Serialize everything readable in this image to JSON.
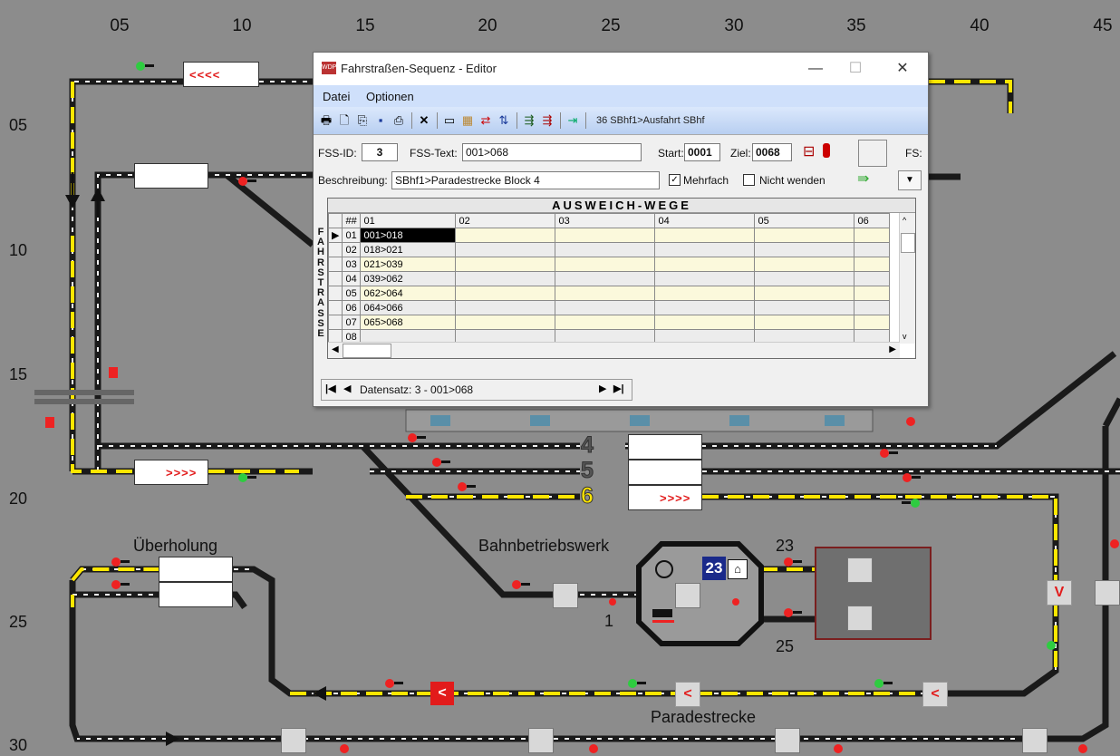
{
  "board": {
    "col_ticks": [
      "05",
      "10",
      "15",
      "20",
      "25",
      "30",
      "35",
      "40",
      "45"
    ],
    "row_ticks": [
      "05",
      "10",
      "15",
      "20",
      "25",
      "30"
    ],
    "track_numbers": [
      "4",
      "5",
      "6"
    ],
    "labels": {
      "ueberholung": "Überholung",
      "bahnbetriebswerk": "Bahnbetriebswerk",
      "paradestrecke": "Paradestrecke",
      "num_23_top": "23",
      "num_25": "25",
      "num_1": "1",
      "depot_badge": "23"
    },
    "arrows_left": "<<<<",
    "arrows_right": ">>>>",
    "arrows_right_6": ">>>>",
    "small_left": "<",
    "v_marker": "V"
  },
  "dialog": {
    "title": "Fahrstraßen-Sequenz - Editor",
    "menu": [
      "Datei",
      "Optionen"
    ],
    "toolbar_status": "36 SBhf1>Ausfahrt SBhf",
    "fss_id_label": "FSS-ID:",
    "fss_id_value": "3",
    "fss_text_label": "FSS-Text:",
    "fss_text_value": "001>068",
    "start_label": "Start:",
    "start_value": "0001",
    "ziel_label": "Ziel:",
    "ziel_value": "0068",
    "fs_label": "FS:",
    "beschreibung_label": "Beschreibung:",
    "beschreibung_value": "SBhf1>Paradestrecke Block 4",
    "mehrfach_label": "Mehrfach",
    "mehrfach_checked": true,
    "nicht_wenden_label": "Nicht wenden",
    "nicht_wenden_checked": false,
    "grid_title": "AUSWEICH-WEGE",
    "side_label": "FAHRSTRASSE",
    "columns": [
      "##",
      "01",
      "02",
      "03",
      "04",
      "05",
      "06"
    ],
    "rows": [
      [
        "01",
        "001>018"
      ],
      [
        "02",
        "018>021"
      ],
      [
        "03",
        "021>039"
      ],
      [
        "04",
        "039>062"
      ],
      [
        "05",
        "062>064"
      ],
      [
        "06",
        "064>066"
      ],
      [
        "07",
        "065>068"
      ],
      [
        "08",
        ""
      ]
    ],
    "nav_text": "Datensatz: 3 - 001>068"
  }
}
